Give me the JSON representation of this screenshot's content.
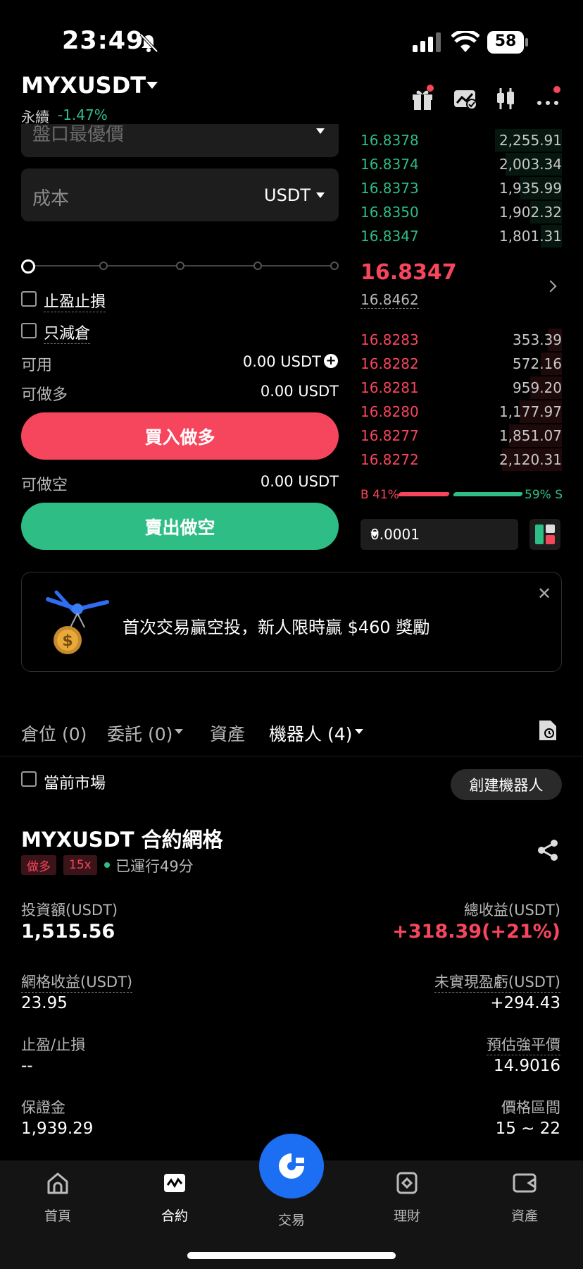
{
  "status_bar": {
    "time": "23:49",
    "battery": "58"
  },
  "header": {
    "symbol": "MYXUSDT",
    "perp_label": "永續",
    "change": "-1.47%",
    "icons": [
      "gift-icon",
      "chart-check-icon",
      "candlestick-icon",
      "more-icon"
    ]
  },
  "order_form": {
    "price_placeholder": "盤口最優價",
    "cost_label": "成本",
    "cost_unit": "USDT",
    "tp_sl_label": "止盈止損",
    "reduce_only_label": "只減倉",
    "available_label": "可用",
    "available_value": "0.00 USDT",
    "can_long_label": "可做多",
    "can_long_value": "0.00 USDT",
    "buy_button": "買入做多",
    "can_short_label": "可做空",
    "can_short_value": "0.00 USDT",
    "sell_button": "賣出做空"
  },
  "order_book": {
    "asks": [
      {
        "price": "16.8378",
        "qty": "2,255.91"
      },
      {
        "price": "16.8374",
        "qty": "2,003.34"
      },
      {
        "price": "16.8373",
        "qty": "1,935.99"
      },
      {
        "price": "16.8350",
        "qty": "1,902.32"
      },
      {
        "price": "16.8347",
        "qty": "1,801.31"
      }
    ],
    "last_price": "16.8347",
    "mark_price": "16.8462",
    "bids": [
      {
        "price": "16.8283",
        "qty": "353.39"
      },
      {
        "price": "16.8282",
        "qty": "572.16"
      },
      {
        "price": "16.8281",
        "qty": "959.20"
      },
      {
        "price": "16.8280",
        "qty": "1,177.97"
      },
      {
        "price": "16.8277",
        "qty": "1,851.07"
      },
      {
        "price": "16.8272",
        "qty": "2,120.31"
      }
    ],
    "buy_ratio": "B 41%",
    "sell_ratio": "59% S",
    "buy_ratio_value": 0.41,
    "step": "0.0001"
  },
  "promo": {
    "text": "首次交易贏空投，新人限時贏 $460 獎勵"
  },
  "tabs": {
    "positions": "倉位 (0)",
    "orders": "委託 (0)",
    "assets": "資產",
    "bots": "機器人 (4)"
  },
  "filter": {
    "current_market": "當前市場",
    "create_bot": "創建機器人"
  },
  "bot": {
    "title": "MYXUSDT 合約網格",
    "tag_side": "做多",
    "tag_leverage": "15x",
    "running": "已運行49分",
    "investment_label": "投資額(USDT)",
    "investment_value": "1,515.56",
    "total_pnl_label": "總收益(USDT)",
    "total_pnl_value": "+318.39(+21%)",
    "grid_pnl_label": "網格收益(USDT)",
    "grid_pnl_value": "23.95",
    "unrealized_label": "未實現盈虧(USDT)",
    "unrealized_value": "+294.43",
    "tpsl_label": "止盈/止損",
    "tpsl_value": "--",
    "liq_label": "預估強平價",
    "liq_value": "14.9016",
    "margin_label": "保證金",
    "margin_value": "1,939.29",
    "range_label": "價格區間",
    "range_value": "15 ~ 22"
  },
  "bottom_nav": {
    "home": "首頁",
    "futures": "合約",
    "trade": "交易",
    "earn": "理財",
    "assets": "資產"
  },
  "colors": {
    "up": "#2ebd85",
    "down": "#f6465d",
    "accent": "#1c6ef2"
  }
}
